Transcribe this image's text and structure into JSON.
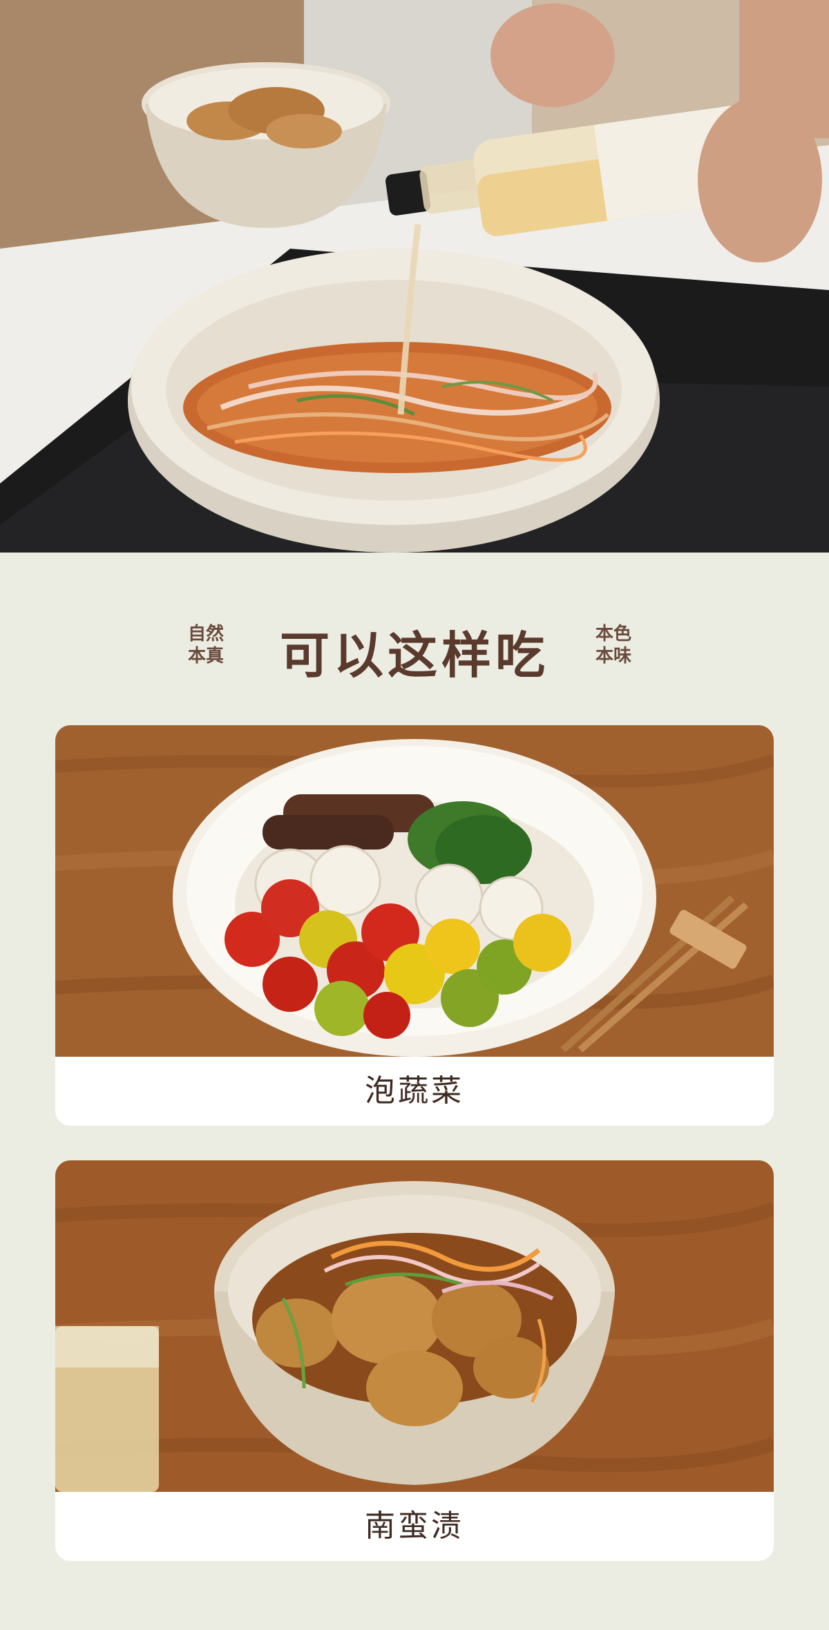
{
  "section": {
    "title": "可以这样吃",
    "left_note": [
      "自然",
      "本真"
    ],
    "right_note": [
      "本色",
      "本味"
    ]
  },
  "dishes": [
    {
      "name": "泡蔬菜"
    },
    {
      "name": "南蛮渍"
    }
  ]
}
